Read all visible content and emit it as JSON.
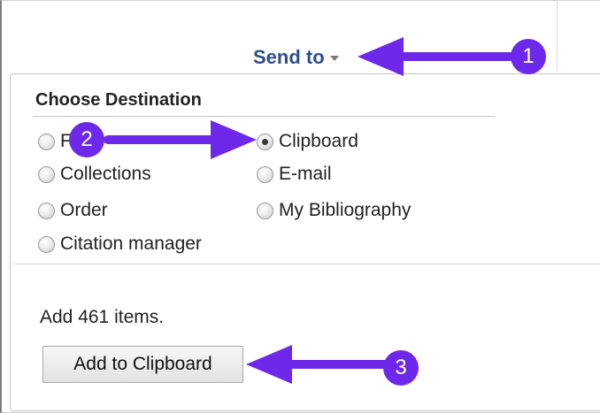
{
  "header": {
    "send_to_label": "Send to"
  },
  "send_to_menu": {
    "title": "Choose Destination",
    "options": [
      {
        "label": "File",
        "checked": false
      },
      {
        "label": "Collections",
        "checked": false
      },
      {
        "label": "Order",
        "checked": false
      },
      {
        "label": "Citation manager",
        "checked": false
      },
      {
        "label": "Clipboard",
        "checked": true
      },
      {
        "label": "E-mail",
        "checked": false
      },
      {
        "label": "My Bibliography",
        "checked": false
      }
    ],
    "add_count_text": "Add 461 items.",
    "add_button_label": "Add to Clipboard"
  },
  "annotations": {
    "step_1": "1",
    "step_2": "2",
    "step_3": "3",
    "color": "#6d28ea"
  }
}
